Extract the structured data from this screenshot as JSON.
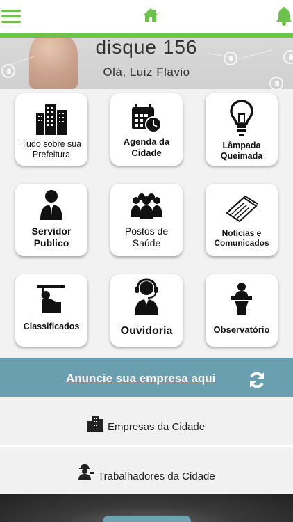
{
  "header": {
    "menu_icon": "hamburger-icon",
    "home_icon": "home-icon",
    "bell_icon": "bell-icon",
    "accent_color": "#6cc24a"
  },
  "hero": {
    "title": "disque 156",
    "greeting": "Olá, Luiz Flavio"
  },
  "tiles": [
    {
      "label": "Tudo sobre sua Prefeitura",
      "icon": "buildings-icon"
    },
    {
      "label": "Agenda da Cidade",
      "icon": "calendar-clock-icon"
    },
    {
      "label": "Lâmpada Queimada",
      "icon": "lightbulb-icon"
    },
    {
      "label": "Servidor Publico",
      "icon": "public-servant-icon"
    },
    {
      "label": "Postos de Saúde",
      "icon": "group-people-icon"
    },
    {
      "label": "Notícias e Comunicados",
      "icon": "newspaper-icon"
    },
    {
      "label": "Classificados",
      "icon": "billboard-person-icon"
    },
    {
      "label": "Ouvidoria",
      "icon": "headset-operator-icon"
    },
    {
      "label": "Observatório",
      "icon": "speaker-podium-icon"
    }
  ],
  "ad": {
    "link_text": "Anuncie sua empresa aqui",
    "refresh_icon": "refresh-icon",
    "bar_color": "#6a9faf"
  },
  "list": [
    {
      "label": "Empresas da Cidade",
      "icon": "buildings-icon"
    },
    {
      "label": "Trabalhadores da Cidade",
      "icon": "worker-icon"
    }
  ]
}
